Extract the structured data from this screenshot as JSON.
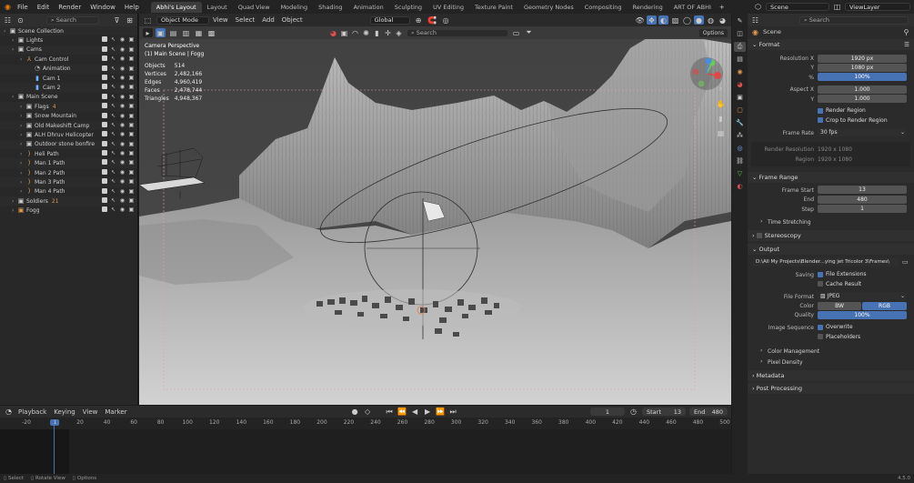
{
  "topbar": {
    "menus": [
      "File",
      "Edit",
      "Render",
      "Window",
      "Help"
    ],
    "workspaces": [
      "Abhi's Layout",
      "Layout",
      "Quad View",
      "Modeling",
      "Shading",
      "Animation",
      "Sculpting",
      "UV Editing",
      "Texture Paint",
      "Geometry Nodes",
      "Compositing",
      "Rendering",
      "ART OF ABHI"
    ],
    "active_workspace": "Abhi's Layout",
    "add_tab": "+",
    "scene_name": "Scene",
    "view_layer": "ViewLayer"
  },
  "outliner": {
    "search_placeholder": "Search",
    "rows": [
      {
        "label": "Scene Collection",
        "depth": 0,
        "icon": "▣",
        "iconColor": "#cfcfcf",
        "extra": ""
      },
      {
        "label": "Lights",
        "depth": 1,
        "icon": "▣",
        "iconColor": "#cfcfcf",
        "extra": ""
      },
      {
        "label": "Cams",
        "depth": 1,
        "icon": "▣",
        "iconColor": "#cfcfcf",
        "extra": ""
      },
      {
        "label": "Cam Control",
        "depth": 2,
        "icon": "⅄",
        "iconColor": "#e09a4a",
        "extra": ""
      },
      {
        "label": "Animation",
        "depth": 3,
        "icon": "◔",
        "iconColor": "#aaaaaa",
        "extra": ""
      },
      {
        "label": "Cam 1",
        "depth": 3,
        "icon": "▮",
        "iconColor": "#74b0ff",
        "extra": ""
      },
      {
        "label": "Cam 2",
        "depth": 3,
        "icon": "▮",
        "iconColor": "#74b0ff",
        "extra": ""
      },
      {
        "label": "Main Scene",
        "depth": 1,
        "icon": "▣",
        "iconColor": "#cfcfcf",
        "extra": ""
      },
      {
        "label": "Flags",
        "depth": 2,
        "icon": "▣",
        "iconColor": "#cfcfcf",
        "extra": "4"
      },
      {
        "label": "Snow Mountain",
        "depth": 2,
        "icon": "▣",
        "iconColor": "#cfcfcf",
        "extra": ""
      },
      {
        "label": "Old Makeshift Camp",
        "depth": 2,
        "icon": "▣",
        "iconColor": "#cfcfcf",
        "extra": ""
      },
      {
        "label": "ALH Dhruv Helicopter",
        "depth": 2,
        "icon": "▣",
        "iconColor": "#cfcfcf",
        "extra": ""
      },
      {
        "label": "Outdoor stone bonfire",
        "depth": 2,
        "icon": "▣",
        "iconColor": "#cfcfcf",
        "extra": ""
      },
      {
        "label": "Heli Path",
        "depth": 2,
        "icon": ")",
        "iconColor": "#e09a4a",
        "extra": ""
      },
      {
        "label": "Man 1 Path",
        "depth": 2,
        "icon": ")",
        "iconColor": "#e09a4a",
        "extra": ""
      },
      {
        "label": "Man 2 Path",
        "depth": 2,
        "icon": ")",
        "iconColor": "#e09a4a",
        "extra": ""
      },
      {
        "label": "Man 3 Path",
        "depth": 2,
        "icon": ")",
        "iconColor": "#e09a4a",
        "extra": ""
      },
      {
        "label": "Man 4 Path",
        "depth": 2,
        "icon": ")",
        "iconColor": "#e09a4a",
        "extra": ""
      },
      {
        "label": "Soldiers",
        "depth": 1,
        "icon": "▣",
        "iconColor": "#cfcfcf",
        "extra": "21"
      },
      {
        "label": "Fogg",
        "depth": 1,
        "icon": "▣",
        "iconColor": "#e09a4a",
        "extra": ""
      }
    ]
  },
  "viewport": {
    "mode": "Object Mode",
    "menus": [
      "View",
      "Select",
      "Add",
      "Object"
    ],
    "orientation": "Global",
    "search_placeholder": "Search",
    "options_label": "Options",
    "camera_title": "Camera Perspective",
    "scene_label": "(1) Main Scene | Fogg",
    "stats": [
      {
        "label": "Objects",
        "value": "514"
      },
      {
        "label": "Vertices",
        "value": "2,482,166"
      },
      {
        "label": "Edges",
        "value": "4,960,419"
      },
      {
        "label": "Faces",
        "value": "2,478,744"
      },
      {
        "label": "Triangles",
        "value": "4,948,367"
      }
    ]
  },
  "properties": {
    "search_placeholder": "Search",
    "context": "Scene",
    "format_section": "Format",
    "res_x_label": "Resolution X",
    "res_x": "1920 px",
    "res_y_label": "Y",
    "res_y": "1080 px",
    "res_pct_label": "%",
    "res_pct": "100%",
    "aspect_x_label": "Aspect X",
    "aspect_x": "1.000",
    "aspect_y_label": "Y",
    "aspect_y": "1.000",
    "render_region": "Render Region",
    "crop_region": "Crop to Render Region",
    "frame_rate_label": "Frame Rate",
    "frame_rate": "30 fps",
    "render_res_label": "Render Resolution",
    "render_res": "1920 x 1080",
    "region_label": "Region",
    "region": "1920 x 1080",
    "frame_range_section": "Frame Range",
    "frame_start_label": "Frame Start",
    "frame_start": "13",
    "end_label": "End",
    "end": "480",
    "step_label": "Step",
    "step": "1",
    "time_stretching": "Time Stretching",
    "stereoscopy": "Stereoscopy",
    "output_section": "Output",
    "output_path": "D:\\All My Projects\\Blender...ying jet Tricolor 3\\Frames\\",
    "saving_label": "Saving",
    "file_ext": "File Extensions",
    "cache_result": "Cache Result",
    "file_format_label": "File Format",
    "file_format": "JPEG",
    "color_label": "Color",
    "color_bw": "BW",
    "color_rgb": "RGB",
    "quality_label": "Quality",
    "quality": "100%",
    "image_seq_label": "Image Sequence",
    "overwrite": "Overwrite",
    "placeholders": "Placeholders",
    "color_management": "Color Management",
    "pixel_density": "Pixel Density",
    "metadata": "Metadata",
    "post_processing": "Post Processing"
  },
  "timeline": {
    "menus": [
      "Playback",
      "Keying",
      "View",
      "Marker"
    ],
    "current_frame": "1",
    "start_label": "Start",
    "start": "13",
    "end_label": "End",
    "end": "480",
    "ticks": [
      "-20",
      "1",
      "20",
      "40",
      "60",
      "80",
      "100",
      "120",
      "140",
      "160",
      "180",
      "200",
      "220",
      "240",
      "260",
      "280",
      "300",
      "320",
      "340",
      "360",
      "380",
      "400",
      "420",
      "440",
      "460",
      "480",
      "500"
    ]
  },
  "status": {
    "select": "Select",
    "rotate": "Rotate View",
    "options": "Options",
    "version": "4.5.0"
  },
  "colors": {
    "accent": "#4772b3",
    "active_frame": "#4772b3",
    "orange": "#e09a4a"
  }
}
